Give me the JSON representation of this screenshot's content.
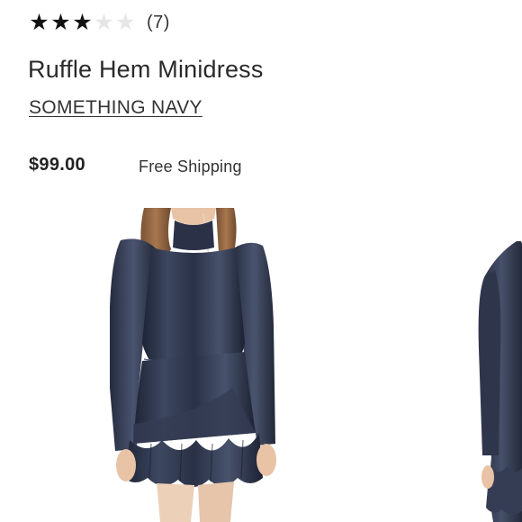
{
  "product": {
    "rating": {
      "value": 3,
      "max": 5,
      "review_count": "(7)"
    },
    "title": "Ruffle Hem Minidress",
    "brand": "SOMETHING NAVY",
    "price": "$99.00",
    "shipping": "Free Shipping"
  },
  "gallery": {
    "main_image": "product-photo-front",
    "next_image": "product-photo-side"
  },
  "colors": {
    "dress": "#2a3146",
    "star_filled": "#111111",
    "star_empty": "#e6e6e6"
  }
}
